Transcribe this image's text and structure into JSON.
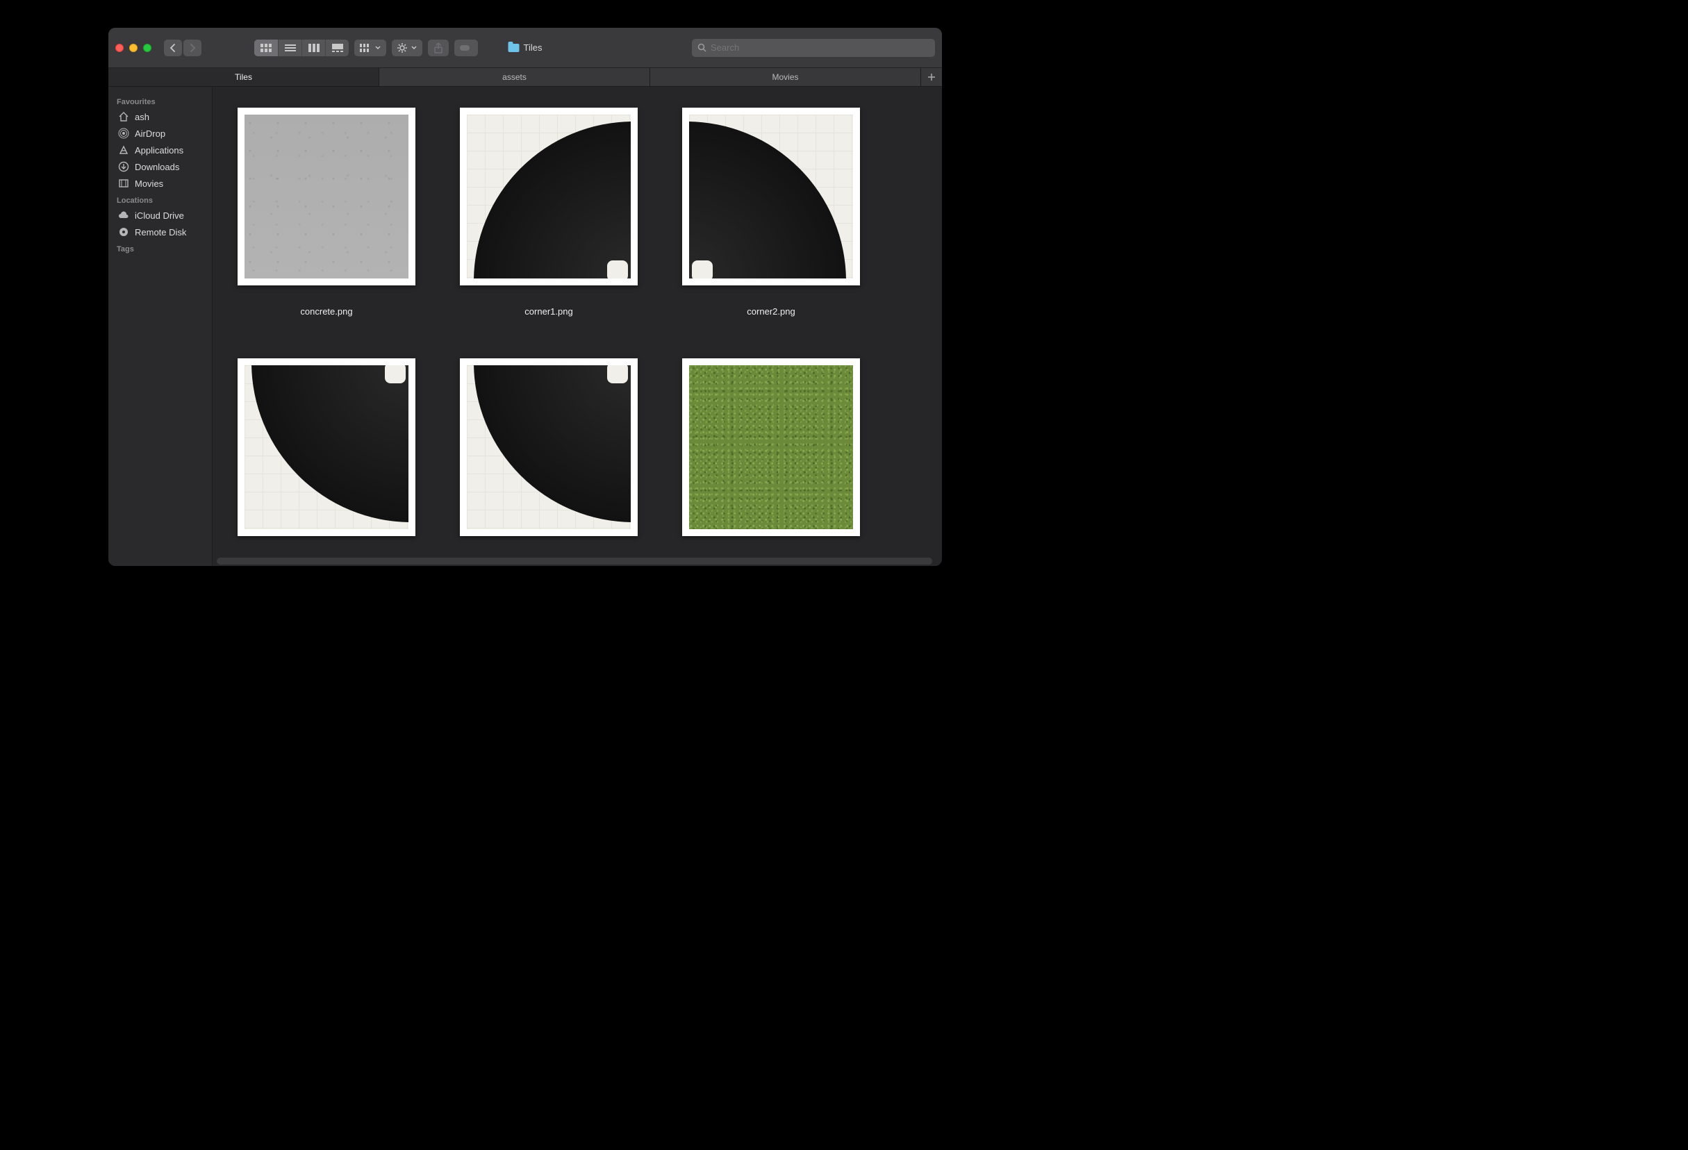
{
  "window": {
    "title": "Tiles"
  },
  "toolbar": {
    "view_modes": [
      "icon",
      "list",
      "column",
      "gallery"
    ],
    "active_view_mode": "icon"
  },
  "search": {
    "placeholder": "Search",
    "value": ""
  },
  "tabs": [
    {
      "label": "Tiles",
      "active": true
    },
    {
      "label": "assets",
      "active": false
    },
    {
      "label": "Movies",
      "active": false
    }
  ],
  "sidebar": {
    "sections": [
      {
        "header": "Favourites",
        "items": [
          {
            "icon": "home-icon",
            "label": "ash"
          },
          {
            "icon": "airdrop-icon",
            "label": "AirDrop"
          },
          {
            "icon": "applications-icon",
            "label": "Applications"
          },
          {
            "icon": "downloads-icon",
            "label": "Downloads"
          },
          {
            "icon": "movies-icon",
            "label": "Movies"
          }
        ]
      },
      {
        "header": "Locations",
        "items": [
          {
            "icon": "cloud-icon",
            "label": "iCloud Drive"
          },
          {
            "icon": "disk-icon",
            "label": "Remote Disk"
          }
        ]
      },
      {
        "header": "Tags",
        "items": []
      }
    ]
  },
  "files": [
    {
      "name": "concrete.png",
      "kind": "concrete"
    },
    {
      "name": "corner1.png",
      "kind": "corner1"
    },
    {
      "name": "corner2.png",
      "kind": "corner2"
    },
    {
      "name": "",
      "kind": "corner3"
    },
    {
      "name": "",
      "kind": "corner4"
    },
    {
      "name": "",
      "kind": "grass"
    }
  ]
}
